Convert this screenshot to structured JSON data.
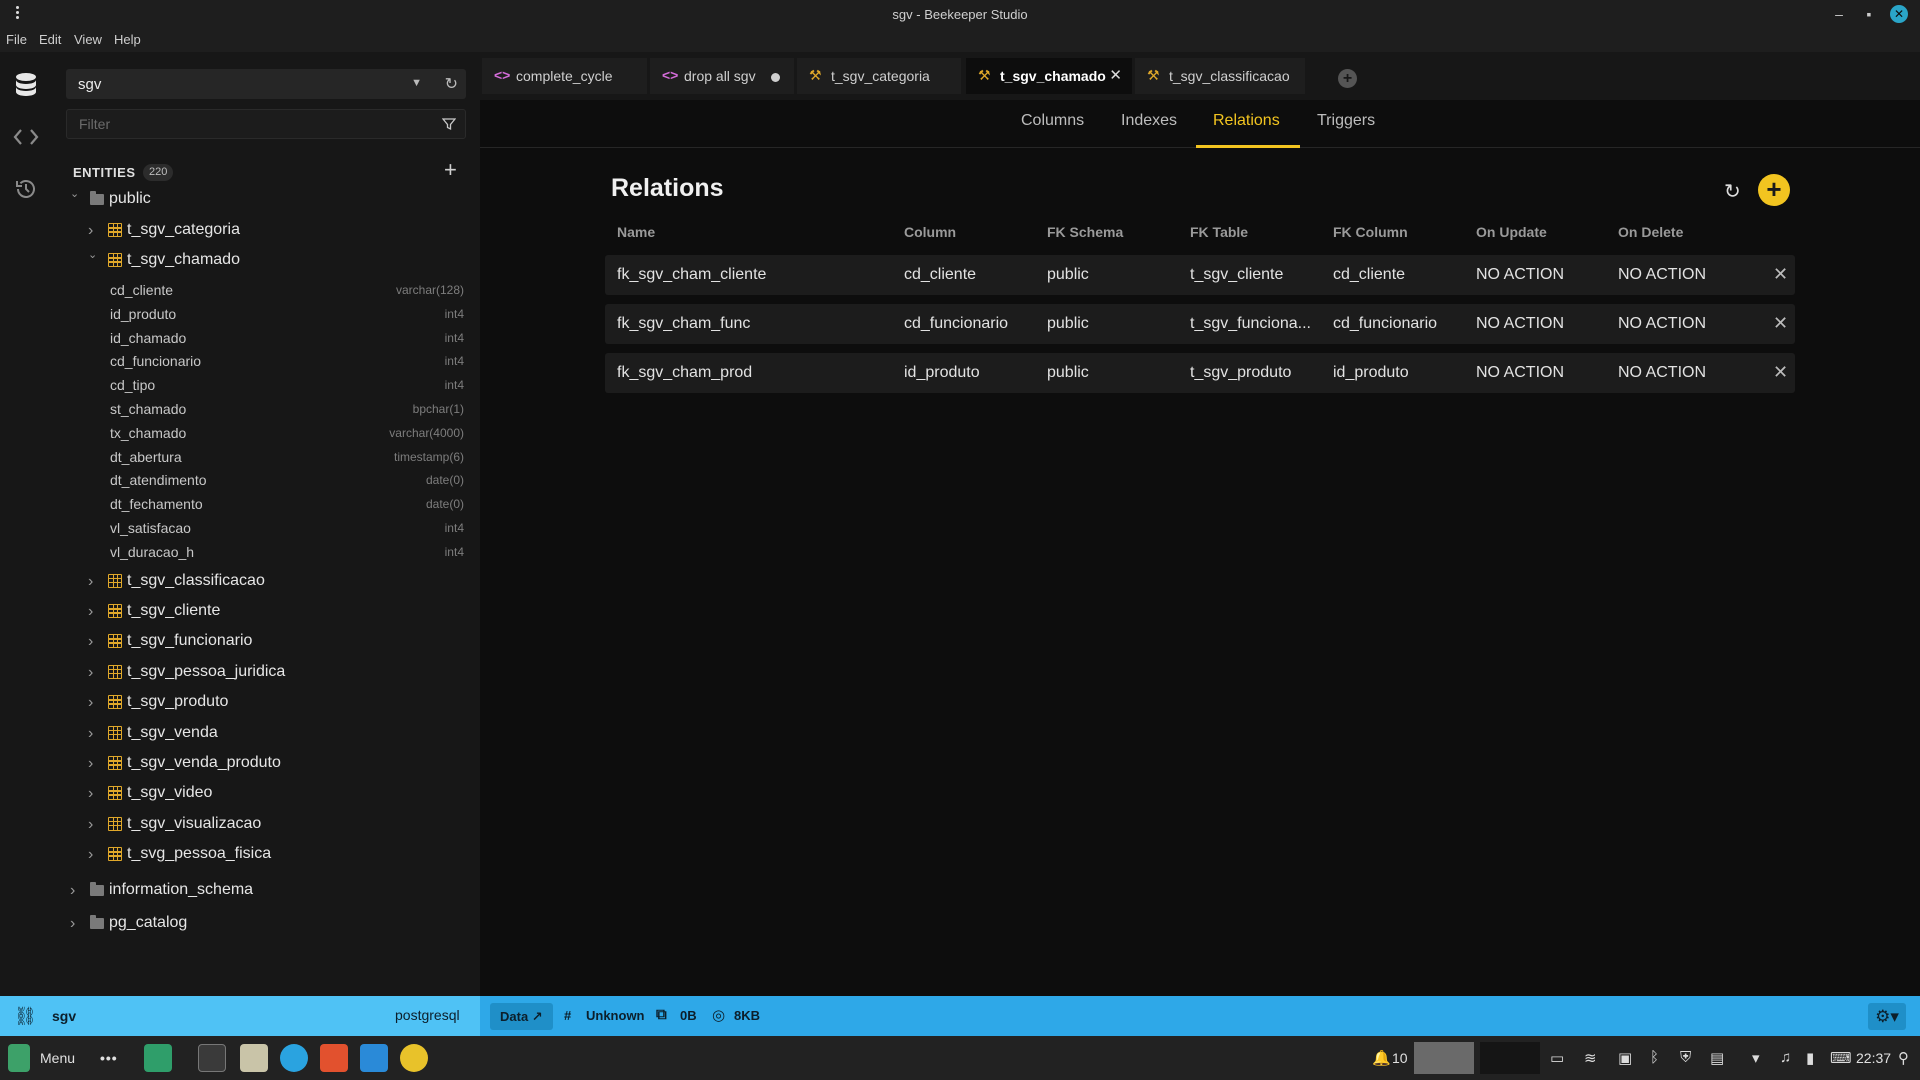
{
  "window": {
    "title": "sgv - Beekeeper Studio"
  },
  "menu": [
    "File",
    "Edit",
    "View",
    "Help"
  ],
  "rail": {
    "icons": [
      "database-icon",
      "code-icon",
      "history-icon"
    ]
  },
  "sidebar": {
    "connection": "sgv",
    "filter_placeholder": "Filter",
    "entities_label": "ENTITIES",
    "entities_count": "220",
    "schema_public": "public",
    "tables_before": [
      "t_sgv_categoria"
    ],
    "expanded_table": "t_sgv_chamado",
    "columns": [
      {
        "name": "cd_cliente",
        "type": "varchar(128)"
      },
      {
        "name": "id_produto",
        "type": "int4"
      },
      {
        "name": "id_chamado",
        "type": "int4"
      },
      {
        "name": "cd_funcionario",
        "type": "int4"
      },
      {
        "name": "cd_tipo",
        "type": "int4"
      },
      {
        "name": "st_chamado",
        "type": "bpchar(1)"
      },
      {
        "name": "tx_chamado",
        "type": "varchar(4000)"
      },
      {
        "name": "dt_abertura",
        "type": "timestamp(6)"
      },
      {
        "name": "dt_atendimento",
        "type": "date(0)"
      },
      {
        "name": "dt_fechamento",
        "type": "date(0)"
      },
      {
        "name": "vl_satisfacao",
        "type": "int4"
      },
      {
        "name": "vl_duracao_h",
        "type": "int4"
      }
    ],
    "tables_after": [
      "t_sgv_classificacao",
      "t_sgv_cliente",
      "t_sgv_funcionario",
      "t_sgv_pessoa_juridica",
      "t_sgv_produto",
      "t_sgv_venda",
      "t_sgv_venda_produto",
      "t_sgv_video",
      "t_sgv_visualizacao",
      "t_svg_pessoa_fisica"
    ],
    "other_schemas": [
      "information_schema",
      "pg_catalog"
    ]
  },
  "tabs": [
    {
      "label": "complete_cycle",
      "kind": "query"
    },
    {
      "label": "drop all sgv",
      "kind": "query",
      "unsaved": true
    },
    {
      "label": "t_sgv_categoria",
      "kind": "table"
    },
    {
      "label": "t_sgv_chamado",
      "kind": "table",
      "active": true
    },
    {
      "label": "t_sgv_classificacao",
      "kind": "table"
    }
  ],
  "subtabs": [
    "Columns",
    "Indexes",
    "Relations",
    "Triggers"
  ],
  "active_subtab": "Relations",
  "relations": {
    "title": "Relations",
    "headers": [
      "Name",
      "Column",
      "FK Schema",
      "FK Table",
      "FK Column",
      "On Update",
      "On Delete"
    ],
    "rows": [
      [
        "fk_sgv_cham_cliente",
        "cd_cliente",
        "public",
        "t_sgv_cliente",
        "cd_cliente",
        "NO ACTION",
        "NO ACTION"
      ],
      [
        "fk_sgv_cham_func",
        "cd_funcionario",
        "public",
        "t_sgv_funciona...",
        "cd_funcionario",
        "NO ACTION",
        "NO ACTION"
      ],
      [
        "fk_sgv_cham_prod",
        "id_produto",
        "public",
        "t_sgv_produto",
        "id_produto",
        "NO ACTION",
        "NO ACTION"
      ]
    ]
  },
  "statusbar": {
    "connection": "sgv",
    "engine": "postgresql",
    "data_button": "Data ↗",
    "encoding": "Unknown",
    "size1": "0B",
    "size2": "8KB"
  },
  "taskbar": {
    "menu_label": "Menu",
    "notifications": "10",
    "clock": "22:37"
  },
  "colors": {
    "accent": "#f2c420",
    "status_bar": "#2ea8e8",
    "table_icon": "#e0a82a",
    "query_icon": "#d46cd9"
  }
}
